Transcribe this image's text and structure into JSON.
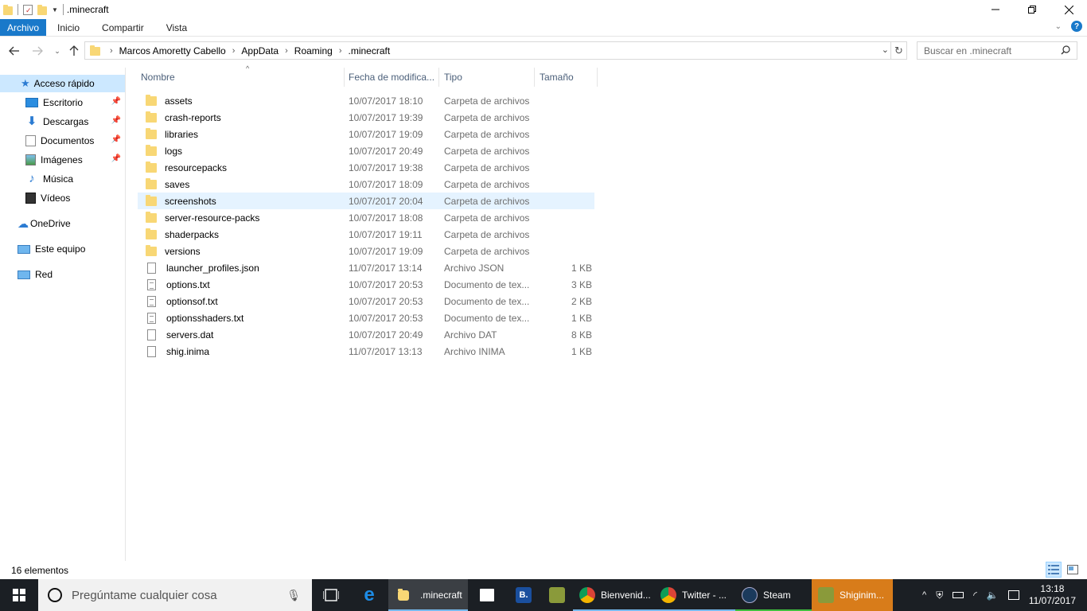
{
  "window": {
    "title": ".minecraft",
    "controls": [
      "minimize",
      "restore",
      "close"
    ]
  },
  "ribbon": {
    "tabs": [
      "Archivo",
      "Inicio",
      "Compartir",
      "Vista"
    ]
  },
  "address": {
    "crumbs": [
      "Marcos Amoretty Cabello",
      "AppData",
      "Roaming",
      ".minecraft"
    ]
  },
  "search": {
    "placeholder": "Buscar en .minecraft"
  },
  "nav": {
    "quick_access": "Acceso rápido",
    "items": [
      {
        "label": "Escritorio",
        "icon": "desktop-icon",
        "pinned": true
      },
      {
        "label": "Descargas",
        "icon": "download-icon",
        "pinned": true
      },
      {
        "label": "Documentos",
        "icon": "documents-icon",
        "pinned": true
      },
      {
        "label": "Imágenes",
        "icon": "pictures-icon",
        "pinned": true
      },
      {
        "label": "Música",
        "icon": "music-icon",
        "pinned": false
      },
      {
        "label": "Vídeos",
        "icon": "videos-icon",
        "pinned": false
      }
    ],
    "onedrive": "OneDrive",
    "this_pc": "Este equipo",
    "network": "Red"
  },
  "columns": [
    "Nombre",
    "Fecha de modifica...",
    "Tipo",
    "Tamaño"
  ],
  "files": [
    {
      "name": "assets",
      "date": "10/07/2017 18:10",
      "type": "Carpeta de archivos",
      "size": "",
      "kind": "folder"
    },
    {
      "name": "crash-reports",
      "date": "10/07/2017 19:39",
      "type": "Carpeta de archivos",
      "size": "",
      "kind": "folder"
    },
    {
      "name": "libraries",
      "date": "10/07/2017 19:09",
      "type": "Carpeta de archivos",
      "size": "",
      "kind": "folder"
    },
    {
      "name": "logs",
      "date": "10/07/2017 20:49",
      "type": "Carpeta de archivos",
      "size": "",
      "kind": "folder"
    },
    {
      "name": "resourcepacks",
      "date": "10/07/2017 19:38",
      "type": "Carpeta de archivos",
      "size": "",
      "kind": "folder"
    },
    {
      "name": "saves",
      "date": "10/07/2017 18:09",
      "type": "Carpeta de archivos",
      "size": "",
      "kind": "folder"
    },
    {
      "name": "screenshots",
      "date": "10/07/2017 20:04",
      "type": "Carpeta de archivos",
      "size": "",
      "kind": "folder",
      "selected": true
    },
    {
      "name": "server-resource-packs",
      "date": "10/07/2017 18:08",
      "type": "Carpeta de archivos",
      "size": "",
      "kind": "folder"
    },
    {
      "name": "shaderpacks",
      "date": "10/07/2017 19:11",
      "type": "Carpeta de archivos",
      "size": "",
      "kind": "folder"
    },
    {
      "name": "versions",
      "date": "10/07/2017 19:09",
      "type": "Carpeta de archivos",
      "size": "",
      "kind": "folder"
    },
    {
      "name": "launcher_profiles.json",
      "date": "11/07/2017 13:14",
      "type": "Archivo JSON",
      "size": "1 KB",
      "kind": "file"
    },
    {
      "name": "options.txt",
      "date": "10/07/2017 20:53",
      "type": "Documento de tex...",
      "size": "3 KB",
      "kind": "txt"
    },
    {
      "name": "optionsof.txt",
      "date": "10/07/2017 20:53",
      "type": "Documento de tex...",
      "size": "2 KB",
      "kind": "txt"
    },
    {
      "name": "optionsshaders.txt",
      "date": "10/07/2017 20:53",
      "type": "Documento de tex...",
      "size": "1 KB",
      "kind": "txt"
    },
    {
      "name": "servers.dat",
      "date": "10/07/2017 20:49",
      "type": "Archivo DAT",
      "size": "8 KB",
      "kind": "file"
    },
    {
      "name": "shig.inima",
      "date": "11/07/2017 13:13",
      "type": "Archivo INIMA",
      "size": "1 KB",
      "kind": "file"
    }
  ],
  "status": {
    "count": "16 elementos"
  },
  "taskbar": {
    "search_placeholder": "Pregúntame cualquier cosa",
    "apps": [
      {
        "label": ".minecraft",
        "icon": "file-explorer-icon"
      },
      {
        "label": "Bienvenid...",
        "icon": "chrome-icon"
      },
      {
        "label": "Twitter - ...",
        "icon": "chrome-icon"
      },
      {
        "label": "Steam",
        "icon": "steam-icon"
      },
      {
        "label": "Shiginim...",
        "icon": "minecraft-icon"
      }
    ],
    "time": "13:18",
    "date": "11/07/2017"
  },
  "colors": {
    "accent": "#1979ca",
    "selection": "#cce8ff",
    "hover_row": "#e5f3ff",
    "folder": "#f8d775",
    "taskbar": "#1b1f24"
  }
}
